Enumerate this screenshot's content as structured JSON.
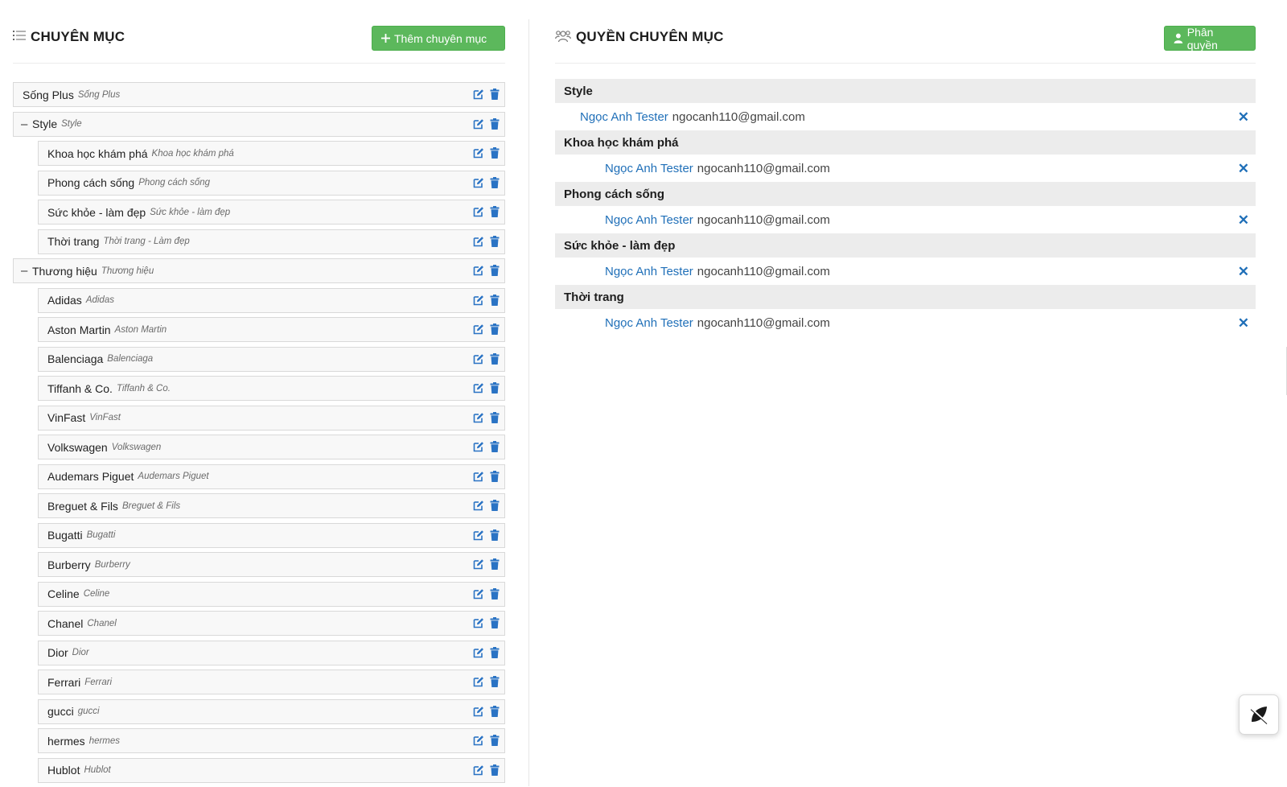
{
  "left_panel": {
    "title": "CHUYÊN MỤC",
    "add_button": "Thêm chuyên mục",
    "categories": [
      {
        "name": "Sống Plus",
        "alias": "Sống Plus",
        "level": 0,
        "toggle": ""
      },
      {
        "name": "Style",
        "alias": "Style",
        "level": 0,
        "toggle": "–"
      },
      {
        "name": "Khoa học khám phá",
        "alias": "Khoa học khám phá",
        "level": 1,
        "toggle": ""
      },
      {
        "name": "Phong cách sống",
        "alias": "Phong cách sống",
        "level": 1,
        "toggle": ""
      },
      {
        "name": "Sức khỏe - làm đẹp",
        "alias": "Sức khỏe - làm đẹp",
        "level": 1,
        "toggle": ""
      },
      {
        "name": "Thời trang",
        "alias": "Thời trang - Làm đẹp",
        "level": 1,
        "toggle": ""
      },
      {
        "name": "Thương hiệu",
        "alias": "Thương hiệu",
        "level": 0,
        "toggle": "–"
      },
      {
        "name": "Adidas",
        "alias": "Adidas",
        "level": 1,
        "toggle": ""
      },
      {
        "name": "Aston Martin",
        "alias": "Aston Martin",
        "level": 1,
        "toggle": ""
      },
      {
        "name": "Balenciaga",
        "alias": "Balenciaga",
        "level": 1,
        "toggle": ""
      },
      {
        "name": "Tiffanh & Co.",
        "alias": "Tiffanh & Co.",
        "level": 1,
        "toggle": ""
      },
      {
        "name": "VinFast",
        "alias": "VinFast",
        "level": 1,
        "toggle": ""
      },
      {
        "name": "Volkswagen",
        "alias": "Volkswagen",
        "level": 1,
        "toggle": ""
      },
      {
        "name": "Audemars Piguet",
        "alias": "Audemars Piguet",
        "level": 1,
        "toggle": ""
      },
      {
        "name": "Breguet & Fils",
        "alias": "Breguet & Fils",
        "level": 1,
        "toggle": ""
      },
      {
        "name": "Bugatti",
        "alias": "Bugatti",
        "level": 1,
        "toggle": ""
      },
      {
        "name": "Burberry",
        "alias": "Burberry",
        "level": 1,
        "toggle": ""
      },
      {
        "name": "Celine",
        "alias": "Celine",
        "level": 1,
        "toggle": ""
      },
      {
        "name": "Chanel",
        "alias": "Chanel",
        "level": 1,
        "toggle": ""
      },
      {
        "name": "Dior",
        "alias": "Dior",
        "level": 1,
        "toggle": ""
      },
      {
        "name": "Ferrari",
        "alias": "Ferrari",
        "level": 1,
        "toggle": ""
      },
      {
        "name": "gucci",
        "alias": "gucci",
        "level": 1,
        "toggle": ""
      },
      {
        "name": "hermes",
        "alias": "hermes",
        "level": 1,
        "toggle": ""
      },
      {
        "name": "Hublot",
        "alias": "Hublot",
        "level": 1,
        "toggle": ""
      }
    ],
    "icons": {
      "header": "list-icon",
      "edit": "edit-icon",
      "delete": "trash-icon"
    }
  },
  "right_panel": {
    "title": "QUYỀN CHUYÊN MỤC",
    "assign_button": "Phân quyền",
    "permissions": [
      {
        "category": "Style",
        "user_name": "Ngọc Anh Tester",
        "email": "ngocanh110@gmail.com",
        "indent": 1
      },
      {
        "category": "Khoa học khám phá",
        "user_name": "Ngọc Anh Tester",
        "email": "ngocanh110@gmail.com",
        "indent": 2
      },
      {
        "category": "Phong cách sống",
        "user_name": "Ngọc Anh Tester",
        "email": "ngocanh110@gmail.com",
        "indent": 2
      },
      {
        "category": "Sức khỏe - làm đẹp",
        "user_name": "Ngọc Anh Tester",
        "email": "ngocanh110@gmail.com",
        "indent": 2
      },
      {
        "category": "Thời trang",
        "user_name": "Ngọc Anh Tester",
        "email": "ngocanh110@gmail.com",
        "indent": 2
      }
    ],
    "remove_symbol": "✕",
    "icons": {
      "header": "users-icon",
      "button": "user-icon"
    }
  },
  "colors": {
    "accent_green": "#5cb85c",
    "link_blue": "#1f6fb8",
    "icon_blue": "#2a73c4",
    "group_bg": "#ececec"
  },
  "floating_button": {
    "icon": "leaf-icon"
  }
}
